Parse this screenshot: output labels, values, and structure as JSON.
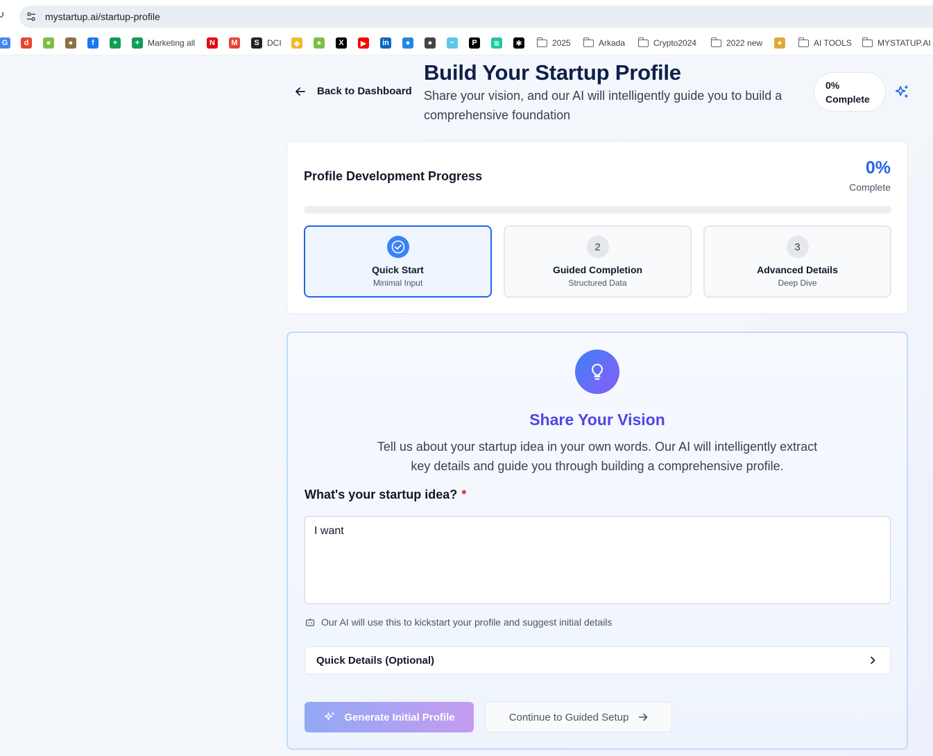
{
  "browser": {
    "url": "mystartup.ai/startup-profile",
    "bookmarks": [
      {
        "label": "",
        "icon": "google-icon",
        "color": "#4285f4",
        "glyph": "G"
      },
      {
        "label": "",
        "icon": "d-icon",
        "color": "#e8452c",
        "glyph": "d"
      },
      {
        "label": "",
        "icon": "parrot-icon",
        "color": "#7bc043",
        "glyph": "●"
      },
      {
        "label": "",
        "icon": "avatar-icon",
        "color": "#8b6f47",
        "glyph": "●"
      },
      {
        "label": "",
        "icon": "facebook-icon",
        "color": "#1877f2",
        "glyph": "f"
      },
      {
        "label": "",
        "icon": "sheets-icon",
        "color": "#0f9d58",
        "glyph": "+"
      },
      {
        "label": "Marketing all",
        "icon": "sheets-icon",
        "color": "#0f9d58",
        "glyph": "+"
      },
      {
        "label": "",
        "icon": "netflix-icon",
        "color": "#e50914",
        "glyph": "N"
      },
      {
        "label": "",
        "icon": "gmail-icon",
        "color": "#ea4335",
        "glyph": "M"
      },
      {
        "label": "DCI",
        "icon": "dci-icon",
        "color": "#222222",
        "glyph": "S"
      },
      {
        "label": "",
        "icon": "binance-icon",
        "color": "#f3ba2f",
        "glyph": "◆"
      },
      {
        "label": "",
        "icon": "parrot-icon",
        "color": "#7bc043",
        "glyph": "●"
      },
      {
        "label": "",
        "icon": "x-icon",
        "color": "#000000",
        "glyph": "X"
      },
      {
        "label": "",
        "icon": "youtube-icon",
        "color": "#ff0000",
        "glyph": "▶"
      },
      {
        "label": "",
        "icon": "linkedin-icon",
        "color": "#0a66c2",
        "glyph": "in"
      },
      {
        "label": "",
        "icon": "app-icon",
        "color": "#1e88e5",
        "glyph": "●"
      },
      {
        "label": "",
        "icon": "globe-icon",
        "color": "#444444",
        "glyph": "●"
      },
      {
        "label": "",
        "icon": "chart-icon",
        "color": "#5ec8e6",
        "glyph": "~"
      },
      {
        "label": "",
        "icon": "pen-icon",
        "color": "#000000",
        "glyph": "P"
      },
      {
        "label": "",
        "icon": "stripes-icon",
        "color": "#1ec8a0",
        "glyph": "≋"
      },
      {
        "label": "",
        "icon": "puzzle-icon",
        "color": "#000000",
        "glyph": "✱"
      },
      {
        "label": "2025",
        "icon": "folder-icon"
      },
      {
        "label": "Arkada",
        "icon": "folder-icon"
      },
      {
        "label": "Crypto2024",
        "icon": "folder-icon"
      },
      {
        "label": "2022 new",
        "icon": "folder-icon"
      },
      {
        "label": "",
        "icon": "robot-icon",
        "color": "#e0a83a",
        "glyph": "✦"
      },
      {
        "label": "AI TOOLS",
        "icon": "folder-icon"
      },
      {
        "label": "MYSTATUP.AI",
        "icon": "folder-icon"
      }
    ]
  },
  "header": {
    "back_label": "Back to Dashboard",
    "title": "Build Your Startup Profile",
    "subtitle": "Share your vision, and our AI will intelligently guide you to build a comprehensive foundation",
    "pill_pct": "0%",
    "pill_label": "Complete"
  },
  "progress": {
    "title": "Profile Development Progress",
    "pct": "0%",
    "pct_label": "Complete",
    "fraction": 0,
    "steps": [
      {
        "marker": "✓",
        "name": "Quick Start",
        "sub": "Minimal Input",
        "active": true
      },
      {
        "marker": "2",
        "name": "Guided Completion",
        "sub": "Structured Data",
        "active": false
      },
      {
        "marker": "3",
        "name": "Advanced Details",
        "sub": "Deep Dive",
        "active": false
      }
    ]
  },
  "vision": {
    "title": "Share Your Vision",
    "description": "Tell us about your startup idea in your own words. Our AI will intelligently extract key details and guide you through building a comprehensive profile.",
    "question": "What's your startup idea?",
    "required_mark": "*",
    "idea_value": "I want",
    "hint": "Our AI will use this to kickstart your profile and suggest initial details",
    "quick_details": "Quick Details (Optional)",
    "generate_button": "Generate Initial Profile",
    "continue_button": "Continue to Guided Setup"
  },
  "colors": {
    "accent": "#2563eb",
    "vision_title": "#4f46e5",
    "required": "#dc2626"
  }
}
